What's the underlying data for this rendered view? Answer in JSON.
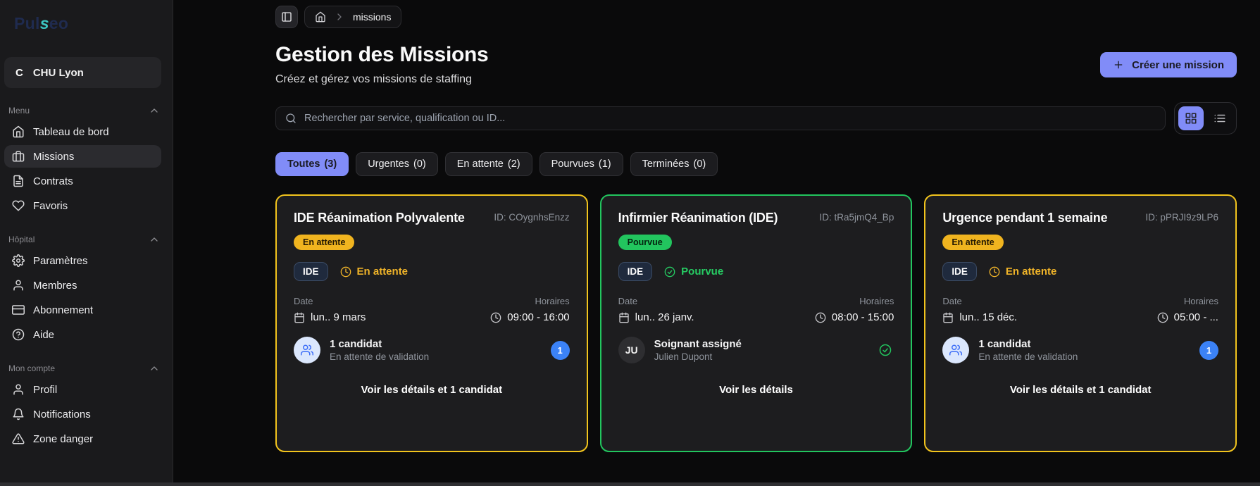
{
  "colors": {
    "accent": "#818cf8",
    "amber_border": "#f2c41d",
    "amber_badge": "#f0b41f",
    "green": "#22c55e",
    "blue": "#3b82f6",
    "teal_logo": "#3cc7c2",
    "navy_logo": "#1f2b4f"
  },
  "brand": {
    "logo_pre": "Pul",
    "logo_mid": "s",
    "logo_post": "eo",
    "org_initial": "C",
    "org_name": "CHU Lyon"
  },
  "sidebar": {
    "sections": [
      {
        "label": "Menu",
        "items": [
          {
            "label": "Tableau de bord"
          },
          {
            "label": "Missions"
          },
          {
            "label": "Contrats"
          },
          {
            "label": "Favoris"
          }
        ]
      },
      {
        "label": "Hôpital",
        "items": [
          {
            "label": "Paramètres"
          },
          {
            "label": "Membres"
          },
          {
            "label": "Abonnement"
          },
          {
            "label": "Aide"
          }
        ]
      },
      {
        "label": "Mon compte",
        "items": [
          {
            "label": "Profil"
          },
          {
            "label": "Notifications"
          },
          {
            "label": "Zone danger"
          }
        ]
      }
    ]
  },
  "breadcrumb": {
    "current": "missions"
  },
  "header": {
    "title": "Gestion des Missions",
    "subtitle": "Créez et gérez vos missions de staffing",
    "create_label": "Créer une mission"
  },
  "search": {
    "placeholder": "Rechercher par service, qualification ou ID..."
  },
  "filters": [
    {
      "label": "Toutes",
      "count": "(3)"
    },
    {
      "label": "Urgentes",
      "count": "(0)"
    },
    {
      "label": "En attente",
      "count": "(2)"
    },
    {
      "label": "Pourvues",
      "count": "(1)"
    },
    {
      "label": "Terminées",
      "count": "(0)"
    }
  ],
  "cards": [
    {
      "title": "IDE Réanimation Polyvalente",
      "id": "ID: COygnhsEnzz",
      "status": "En attente",
      "qualification": "IDE",
      "inline_status": "En attente",
      "date_label": "Date",
      "date": "lun.. 9 mars",
      "hours_label": "Horaires",
      "hours": "09:00 - 16:00",
      "candidate_title": "1 candidat",
      "candidate_subtitle": "En attente de validation",
      "candidate_count": "1",
      "footer": "Voir les détails et 1 candidat"
    },
    {
      "title": "Infirmier Réanimation (IDE)",
      "id": "ID: tRa5jmQ4_Bp",
      "status": "Pourvue",
      "qualification": "IDE",
      "inline_status": "Pourvue",
      "date_label": "Date",
      "date": "lun.. 26 janv.",
      "hours_label": "Horaires",
      "hours": "08:00 - 15:00",
      "assignee_initials": "JU",
      "candidate_title": "Soignant assigné",
      "candidate_subtitle": "Julien Dupont",
      "footer": "Voir les détails"
    },
    {
      "title": "Urgence pendant 1 semaine",
      "id": "ID: pPRJI9z9LP6",
      "status": "En attente",
      "qualification": "IDE",
      "inline_status": "En attente",
      "date_label": "Date",
      "date": "lun.. 15 déc.",
      "hours_label": "Horaires",
      "hours": "05:00 - ...",
      "candidate_title": "1 candidat",
      "candidate_subtitle": "En attente de validation",
      "candidate_count": "1",
      "footer": "Voir les détails et 1 candidat"
    }
  ]
}
